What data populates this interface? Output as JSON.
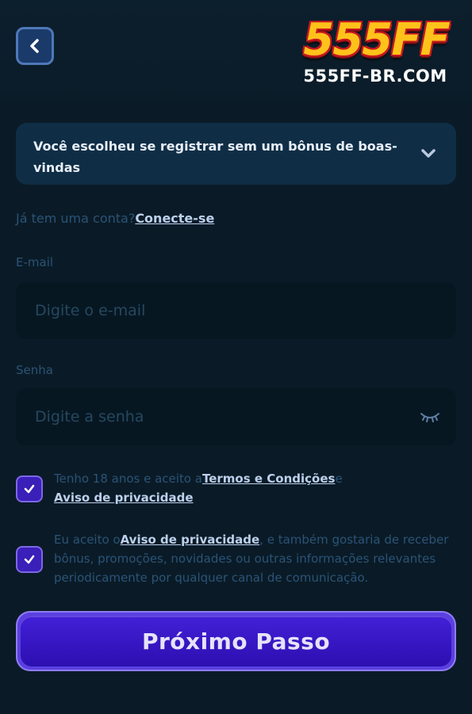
{
  "header": {
    "logo_main": "555FF",
    "logo_sub": "555FF-BR.COM"
  },
  "bonus": {
    "text": "Você escolheu se registrar sem um bônus de boas-vindas"
  },
  "login": {
    "prompt": "Já tem uma conta?",
    "link": "Conecte-se"
  },
  "email": {
    "label": "E-mail",
    "placeholder": "Digite o e-mail",
    "value": ""
  },
  "password": {
    "label": "Senha",
    "placeholder": "Digite a senha",
    "value": ""
  },
  "terms": {
    "checked": true,
    "text_before": "Tenho 18 anos e aceito a",
    "terms_link": "Termos e Condições",
    "text_between": "e",
    "privacy_link": "Aviso de privacidade"
  },
  "marketing": {
    "checked": true,
    "text_before": "Eu aceito o",
    "privacy_link": "Aviso de privacidade",
    "text_after": ", e também gostaria de receber bônus, promoções, novidades ou outras informações relevantes periodicamente por qualquer canal de comunicação."
  },
  "next_button": {
    "label": "Próximo Passo"
  },
  "colors": {
    "background": "#0a1b27",
    "accent": "#3a1fb8",
    "link": "#bcd0ec"
  },
  "icons": {
    "back": "chevron-left-icon",
    "dropdown": "chevron-down-icon",
    "password_toggle": "eye-closed-icon",
    "checkbox": "checkmark-icon"
  }
}
